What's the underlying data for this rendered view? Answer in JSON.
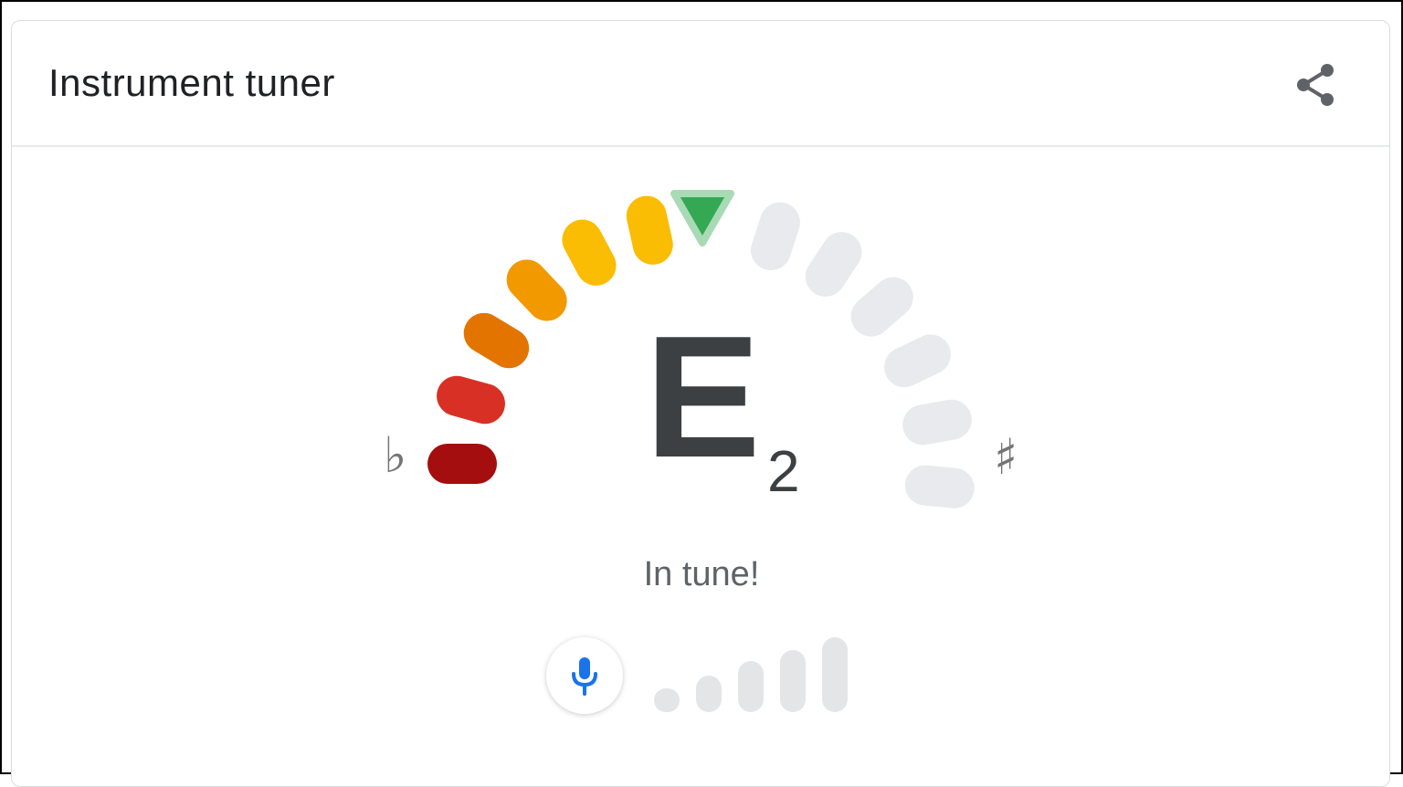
{
  "header": {
    "title": "Instrument tuner",
    "share_icon": "share-icon"
  },
  "tuner": {
    "note": "E",
    "octave": "2",
    "flat_symbol": "♭",
    "sharp_symbol": "♯",
    "status": "In tune!",
    "active_segments": 6,
    "total_segments": 12,
    "indicator_color": "#34a853",
    "segment_colors": [
      "#a50e0e",
      "#d93025",
      "#e37400",
      "#f29900",
      "#fbbc04",
      "#fbbc04"
    ],
    "inactive_color": "#e8eaed"
  },
  "microphone": {
    "icon": "microphone-icon",
    "icon_color": "#1a73e8",
    "level_bars": 5
  }
}
